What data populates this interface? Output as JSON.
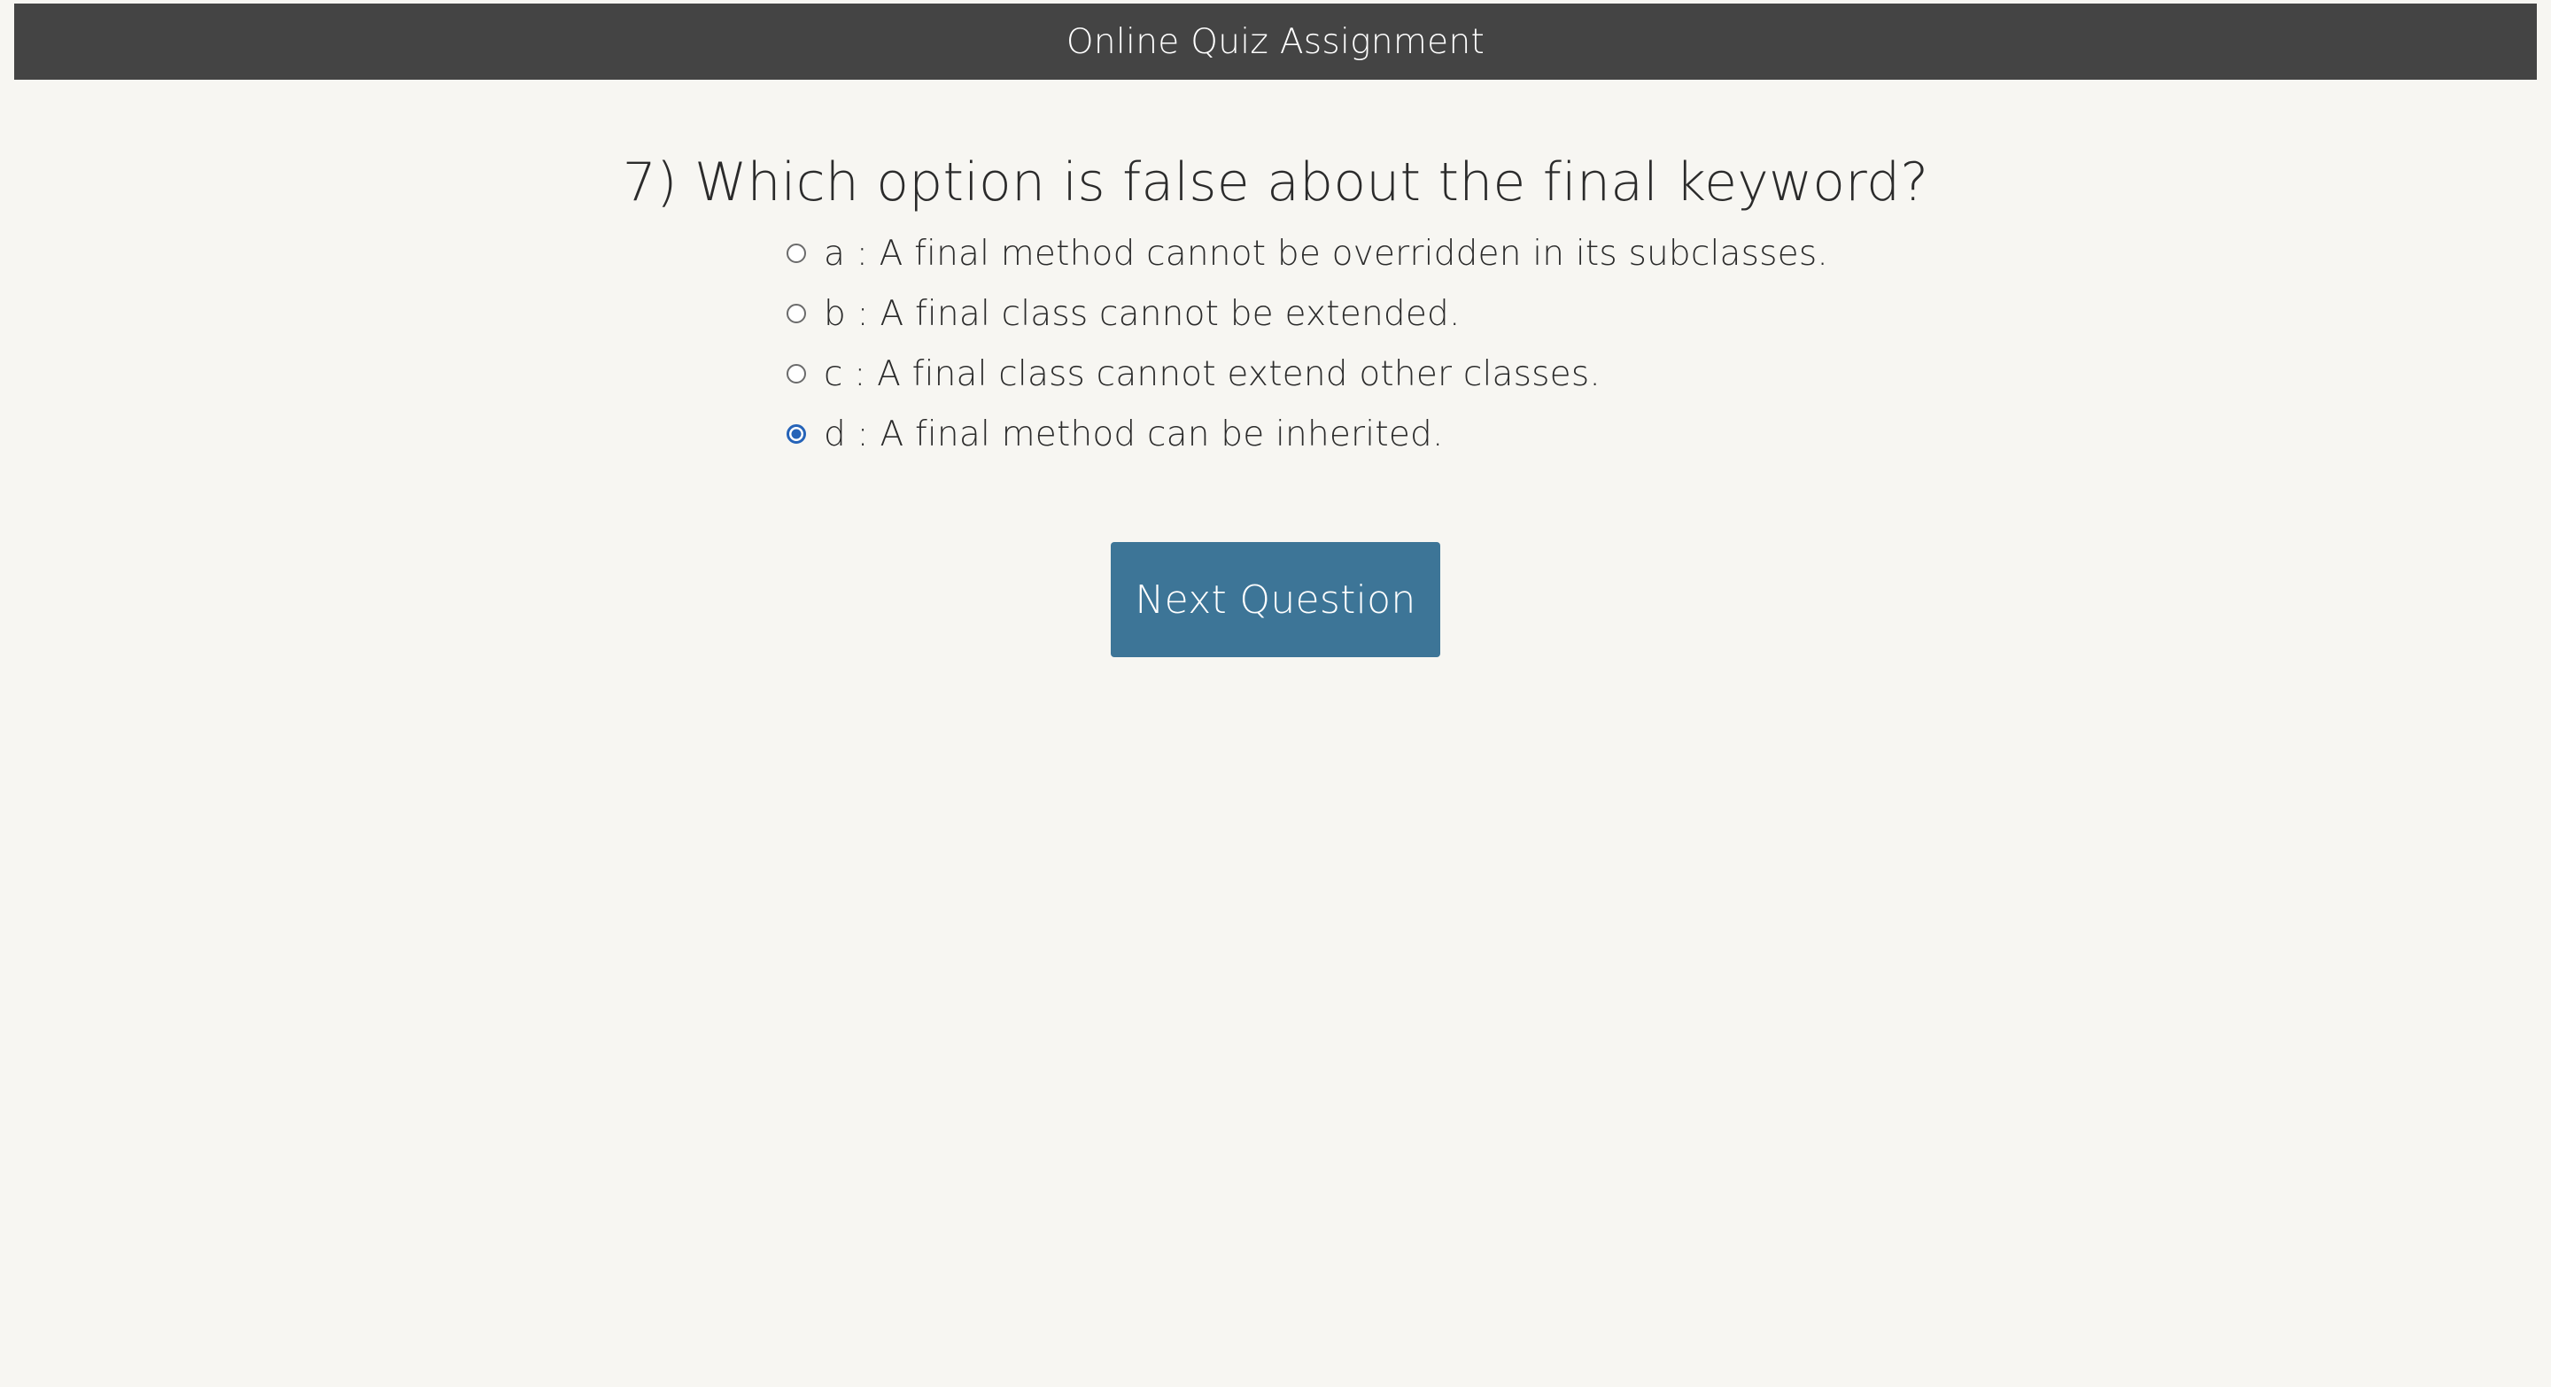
{
  "header": {
    "title": "Online Quiz Assignment"
  },
  "question": {
    "text": "7) Which option is false about the final keyword?",
    "options": [
      {
        "label": "a : A final method cannot be overridden in its subclasses.",
        "selected": false
      },
      {
        "label": "b : A final class cannot be extended.",
        "selected": false
      },
      {
        "label": "c : A final class cannot extend other classes.",
        "selected": false
      },
      {
        "label": "d : A final method can be inherited.",
        "selected": true
      }
    ]
  },
  "actions": {
    "next_label": "Next Question"
  },
  "colors": {
    "header_bg": "#444444",
    "page_bg": "#f7f6f2",
    "button_bg": "#3d7597",
    "radio_selected": "#2563b8"
  }
}
